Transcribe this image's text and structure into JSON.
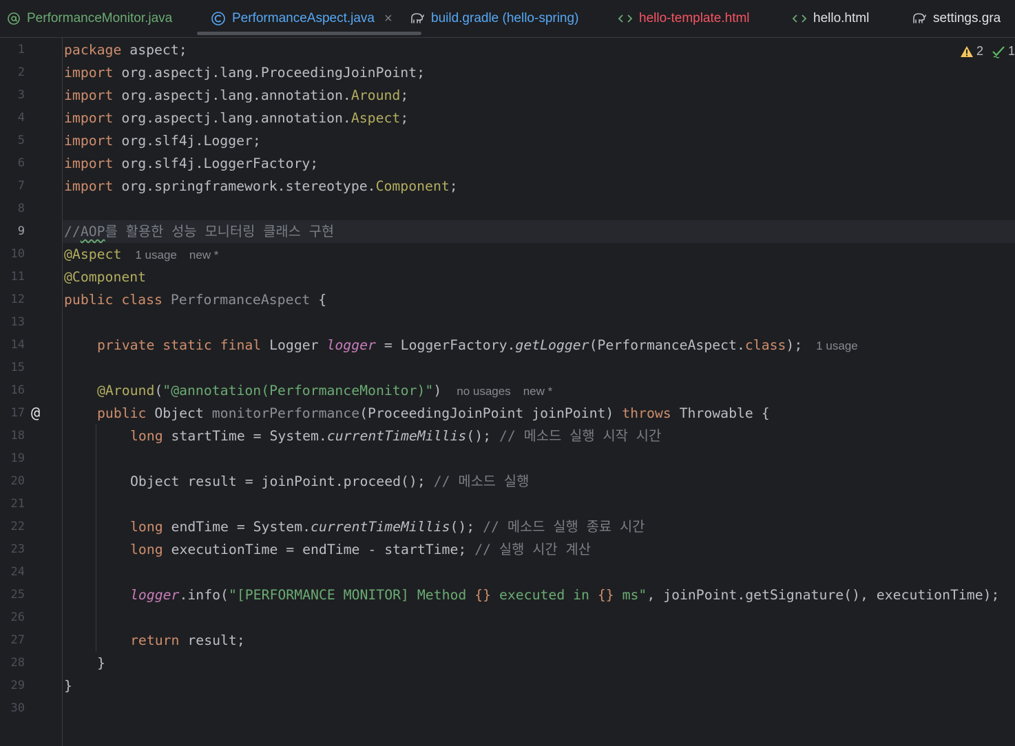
{
  "tabs": [
    {
      "label": "PerformanceMonitor.java",
      "icon": "annotation-icon"
    },
    {
      "label": "PerformanceAspect.java",
      "icon": "aspect-class-icon",
      "close": "×"
    },
    {
      "label": "build.gradle (hello-spring)",
      "icon": "gradle-elephant-icon"
    },
    {
      "label": "hello-template.html",
      "icon": "html-tag-icon"
    },
    {
      "label": "hello.html",
      "icon": "html-tag-icon"
    },
    {
      "label": "settings.gra",
      "icon": "gradle-elephant-icon"
    }
  ],
  "inspections": {
    "warnings": "2",
    "ok": "1"
  },
  "current_line": 9,
  "line_numbers": [
    "1",
    "2",
    "3",
    "4",
    "5",
    "6",
    "7",
    "8",
    "9",
    "10",
    "11",
    "12",
    "13",
    "14",
    "15",
    "16",
    "17",
    "18",
    "19",
    "20",
    "21",
    "22",
    "23",
    "24",
    "25",
    "26",
    "27",
    "28",
    "29",
    "30"
  ],
  "gutter_marker": {
    "line": 17,
    "symbol": "@"
  },
  "code": {
    "l1": [
      "package",
      " aspect;"
    ],
    "l2": [
      "import",
      " org.aspectj.lang.ProceedingJoinPoint;"
    ],
    "l3": [
      "import",
      " org.aspectj.lang.annotation.",
      "Around",
      ";"
    ],
    "l4": [
      "import",
      " org.aspectj.lang.annotation.",
      "Aspect",
      ";"
    ],
    "l5": [
      "import",
      " org.slf4j.Logger;"
    ],
    "l6": [
      "import",
      " org.slf4j.LoggerFactory;"
    ],
    "l7": [
      "import",
      " org.springframework.stereotype.",
      "Component",
      ";"
    ],
    "l9": [
      "//",
      "AOP",
      "를 활용한 성능 모니터링 클래스 구현"
    ],
    "l10": [
      "@Aspect",
      "1 usage",
      "new *"
    ],
    "l11": [
      "@Component"
    ],
    "l12": [
      "public class",
      " ",
      "PerformanceAspect",
      " {"
    ],
    "l14": [
      "private static final",
      " Logger ",
      "logger",
      " = LoggerFactory.",
      "getLogger",
      "(PerformanceAspect.",
      "class",
      ");",
      "1 usage"
    ],
    "l16": [
      "@Around",
      "(",
      "\"@annotation(PerformanceMonitor)\"",
      ")",
      "no usages",
      "new *"
    ],
    "l17": [
      "public",
      " Object ",
      "monitorPerformance",
      "(ProceedingJoinPoint joinPoint) ",
      "throws",
      " Throwable {"
    ],
    "l18": [
      "long",
      " startTime = System.",
      "currentTimeMillis",
      "(); ",
      "// 메소드 실행 시작 시간"
    ],
    "l20": [
      "Object result = joinPoint.proceed(); ",
      "// 메소드 실행"
    ],
    "l22": [
      "long",
      " endTime = System.",
      "currentTimeMillis",
      "(); ",
      "// 메소드 실행 종료 시간"
    ],
    "l23": [
      "long",
      " executionTime = endTime - startTime; ",
      "// 실행 시간 계산"
    ],
    "l25": [
      "logger",
      ".info(",
      "\"[PERFORMANCE MONITOR] Method ",
      "{}",
      " executed in ",
      "{}",
      " ms\"",
      ", joinPoint.getSignature(), executionTime);"
    ],
    "l27": [
      "return",
      " result;"
    ],
    "l28": [
      "}"
    ],
    "l29": [
      "}"
    ]
  }
}
